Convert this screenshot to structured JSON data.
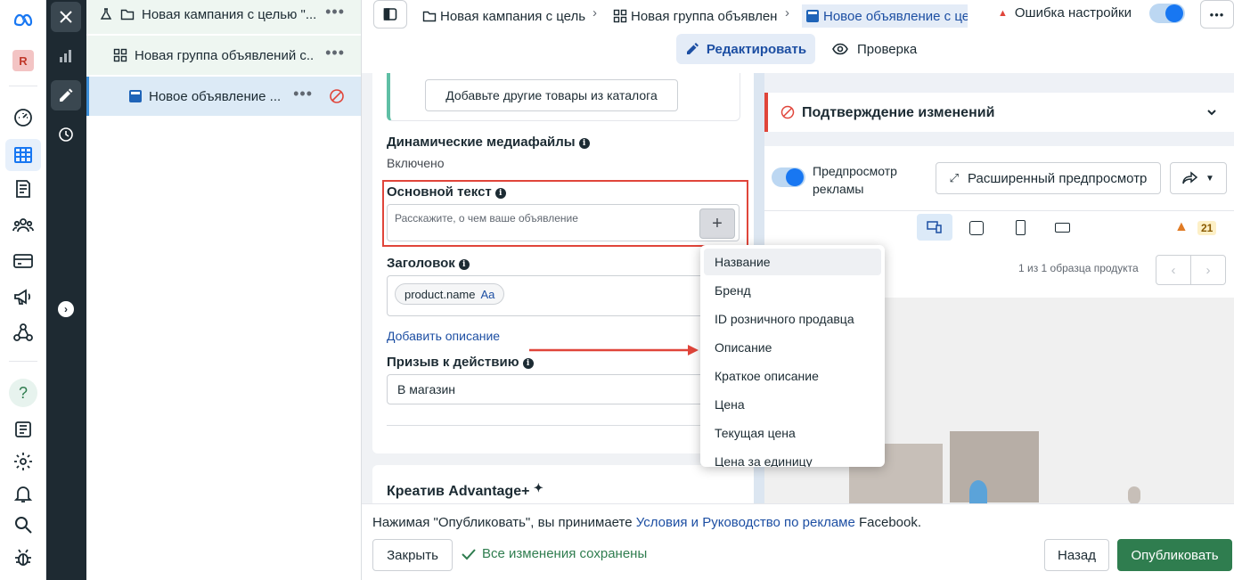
{
  "rail": {
    "logo_icon": "meta-logo-icon",
    "avatar_letter": "R",
    "items": [
      "dashboard-icon",
      "ads-manager-table-icon",
      "pages-icon",
      "audiences-icon",
      "billing-icon",
      "campaigns-megaphone-icon",
      "hierarchy-icon",
      "help-icon",
      "news-icon",
      "settings-icon",
      "notifications-icon",
      "search-icon",
      "bug-icon"
    ]
  },
  "tree": {
    "campaign": "Новая кампания с целью \"...",
    "adset": "Новая группа объявлений с...",
    "ad": "Новое объявление ...",
    "more": "•••"
  },
  "topbar": {
    "crumb_campaign": "Новая кампания с цель",
    "crumb_adset": "Новая группа объявлен",
    "crumb_ad": "Новое объявление с цел",
    "error_label": "Ошибка настройки",
    "more": "•••",
    "tab_edit": "Редактировать",
    "tab_review": "Проверка"
  },
  "form": {
    "add_products_button": "Добавьте другие товары из каталога",
    "dynamic_media_label": "Динамические медиафайлы",
    "dynamic_media_value": "Включено",
    "primary_text_label": "Основной текст",
    "primary_text_placeholder": "Расскажите, о чем ваше объявление",
    "plus": "+",
    "headline_label": "Заголовок",
    "headline_chip": "product.name",
    "headline_chip_suffix": "Aa",
    "add_description": "Добавить описание",
    "cta_label": "Призыв к действию",
    "cta_value": "В магазин",
    "advantage_title": "Креатив Advantage+"
  },
  "menu": {
    "items": [
      "Название",
      "Бренд",
      "ID розничного продавца",
      "Описание",
      "Краткое описание",
      "Цена",
      "Текущая цена",
      "Цена за единицу"
    ]
  },
  "preview": {
    "confirm_title": "Подтверждение изменений",
    "ad_preview_label_1": "Предпросмотр",
    "ad_preview_label_2": "рекламы",
    "advanced_preview": "Расширенный предпросмотр",
    "warning_count": "21",
    "sample_counter": "1 из 1 образца продукта"
  },
  "footer": {
    "terms_prefix": "Нажимая \"Опубликовать\", вы принимаете ",
    "terms_link": "Условия и Руководство по рекламе",
    "terms_suffix": " Facebook.",
    "close_button": "Закрыть",
    "saved_status": "Все изменения сохранены",
    "back_button": "Назад",
    "publish_button": "Опубликовать"
  },
  "colors": {
    "brand_blue": "#1877f2",
    "publish_green": "#2f7d4f",
    "highlight_red": "#e0453a",
    "tree_selected": "#e7f3ee",
    "edit_tab_bg": "#e4ecf7"
  }
}
